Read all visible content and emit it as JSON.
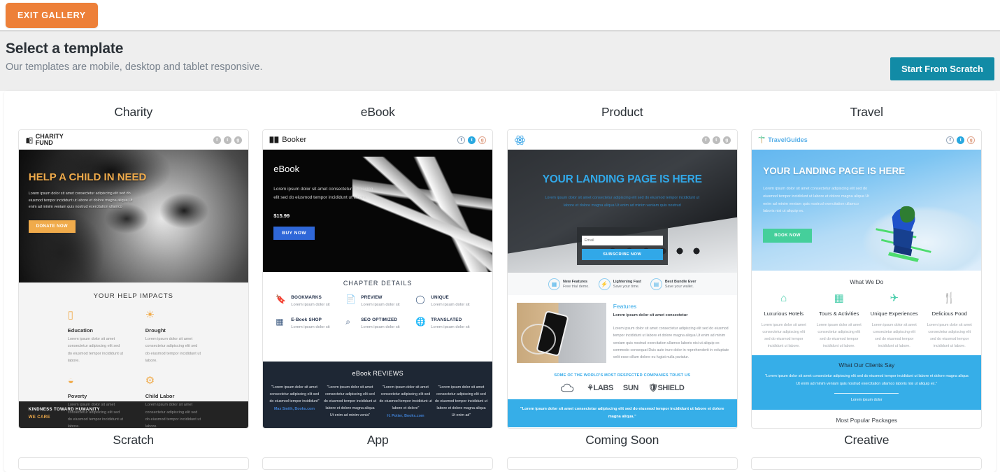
{
  "topbar": {
    "exit_label": "EXIT GALLERY"
  },
  "subheader": {
    "title": "Select a template",
    "subtitle": "Our templates are mobile, desktop and tablet responsive.",
    "scratch_label": "Start From Scratch"
  },
  "colors": {
    "exit_orange": "#ed8039",
    "scratch_teal": "#128ba6",
    "subheader_bg": "#eeeeee",
    "charity_accent": "#f0ab4b",
    "ebook_accent": "#2f67d8",
    "product_accent": "#31a8e8",
    "travel_accent": "#45cf9b"
  },
  "templates": [
    {
      "name": "Charity"
    },
    {
      "name": "eBook"
    },
    {
      "name": "Product"
    },
    {
      "name": "Travel"
    },
    {
      "name": "Scratch"
    },
    {
      "name": "App"
    },
    {
      "name": "Coming Soon"
    },
    {
      "name": "Creative"
    }
  ],
  "charity": {
    "logo_line1": "CHARITY",
    "logo_line2": "FUND",
    "hero_title": "HELP A CHILD IN NEED",
    "hero_body": "Lorem ipsum dolor sit amet consectetur adipiscing elit sed do eiusmod tempor incididunt ut labore et dolore magna aliqua Ut enim ad minim veniam quis nostrud exercitation ullamco",
    "cta": "DONATE NOW",
    "section_title": "YOUR HELP IMPACTS",
    "items": [
      {
        "icon": "book-icon",
        "glyph": "▯",
        "title": "Education",
        "body": "Lorem ipsum dolor sit amet consectetur adipiscing elit sed do eiusmod tempor incididunt ut labore."
      },
      {
        "icon": "sun-icon",
        "glyph": "☀",
        "title": "Drought",
        "body": "Lorem ipsum dolor sit amet consectetur adipiscing elit sed do eiusmod tempor incididunt ut labore."
      },
      {
        "icon": "bowl-icon",
        "glyph": "◒",
        "title": "Poverty",
        "body": "Lorem ipsum dolor sit amet consectetur adipiscing elit sed do eiusmod tempor incididunt ut labore."
      },
      {
        "icon": "gears-icon",
        "glyph": "⚙",
        "title": "Child Labor",
        "body": "Lorem ipsum dolor sit amet consectetur adipiscing elit sed do eiusmod tempor incididunt ut labore."
      }
    ],
    "footer_line1": "KINDNESS TOWARD HUMANITY",
    "footer_line2": "WE CARE"
  },
  "ebook": {
    "logo": "Booker",
    "hero_title": "eBook",
    "hero_body": "Lorem ipsum dolor sit amet consectetur adipiscing elit sed do eiusmod tempor incididunt ut labore.",
    "price": "$15.99",
    "cta": "BUY NOW",
    "section_title": "CHAPTER DETAILS",
    "features": [
      {
        "icon": "bookmark-icon",
        "glyph": "🔖",
        "title": "BOOKMARKS",
        "body": "Lorem ipsum dolor sit"
      },
      {
        "icon": "document-icon",
        "glyph": "📄",
        "title": "PREVIEW",
        "body": "Lorem ipsum dolor sit"
      },
      {
        "icon": "location-pin-icon",
        "glyph": "📍",
        "title": "UNIQUE",
        "body": "Lorem ipsum dolor sit"
      },
      {
        "icon": "shop-icon",
        "glyph": "🏪",
        "title": "E-Book SHOP",
        "body": "Lorem ipsum dolor sit"
      },
      {
        "icon": "magnifier-icon",
        "glyph": "🔍",
        "title": "SEO OPTIMIZED",
        "body": "Lorem ipsum dolor sit"
      },
      {
        "icon": "globe-icon",
        "glyph": "🌐",
        "title": "TRANSLATED",
        "body": "Lorem ipsum dolor sit"
      }
    ],
    "reviews_title": "eBook REVIEWS",
    "reviews": [
      {
        "text": "\"Lorem ipsum dolor sit amet consectetur adipiscing elit sed do eiusmod tempor incididunt\"",
        "author": "Max Smith, Books.com"
      },
      {
        "text": "\"Lorem ipsum dolor sit amet consectetur adipiscing elit sed do eiusmod tempor incididunt ut labore et dolore magna aliqua Ut enim ad minim venia\"",
        "author": ""
      },
      {
        "text": "\"Lorem ipsum dolor sit amet consectetur adipiscing elit sed do eiusmod tempor incididunt ut labore et dolore\"",
        "author": "H. Potter, Books.com"
      },
      {
        "text": "\"Lorem ipsum dolor sit amet consectetur adipiscing elit sed do eiusmod tempor incididunt ut labore et dolore magna aliqua Ut enim ad\"",
        "author": ""
      }
    ]
  },
  "product": {
    "logo": "atom-icon",
    "hero_title": "YOUR LANDING PAGE IS HERE",
    "hero_body": "Lorem ipsum dolor sit amet consectetur adipiscing elit sed do eiusmod tempor incididunt ut labore et dolore magna aliqua Ut enim ad minim veniam quis nostrud",
    "email_placeholder": "Email",
    "subscribe_label": "SUBSCRIBE NOW",
    "features": [
      {
        "icon": "card-icon",
        "glyph": "▤",
        "title": "New Features",
        "sub": "Free trial demo."
      },
      {
        "icon": "bolt-icon",
        "glyph": "⚡",
        "title": "Lightening Fast",
        "sub": "Save your time."
      },
      {
        "icon": "map-icon",
        "glyph": "🗺",
        "title": "Best Bundle Ever",
        "sub": "Save your wallet."
      }
    ],
    "features_title": "Features",
    "features_sub": "Lorem ipsum dolor sit amet consectetur",
    "features_body": "Lorem ipsum dolor sit amet consectetur adipiscing elit sed do eiusmod tempor incididunt ut labore et dolore magna aliqua Ut enim ad minim veniam quis nostrud exercitation ullamco laboris nisi ut aliquip ex commodo consequat Duis aute irure dolor in reprehenderit in voluptate velit esse cillum dolore eu fugiat nulla pariatur.",
    "trust_title": "SOME OF THE WORLD'S MOST RESPECTED COMPANIES TRUST US",
    "logos": [
      {
        "icon": "cloud-icon",
        "label": ""
      },
      {
        "icon": "labs-icon",
        "label": "LABS"
      },
      {
        "icon": "sun-logo-icon",
        "label": "SUN"
      },
      {
        "icon": "shield-icon",
        "label": "SHIELD"
      }
    ],
    "quote": "\"Lorem ipsum dolor sit amet consectetur adipiscing elit sed do eiusmod tempor incididunt ut labore et dolore magna aliqua.\""
  },
  "travel": {
    "logo": "TravelGuides",
    "hero_title": "YOUR LANDING PAGE IS HERE",
    "hero_body": "Lorem ipsum dolor sit amet consectetur adipiscing elit sed do eiusmod tempor incididunt ut labore et dolore magna aliqua Ut enim ad minim veniam quis nostrud exercitation ullamco laboris nisi ut aliquip ex.",
    "cta": "BOOK NOW",
    "section_title": "What We Do",
    "items": [
      {
        "icon": "home-icon",
        "glyph": "⌂",
        "title": "Luxurious Hotels",
        "body": "Lorem ipsum dolor sit amet consectetur adipiscing elit sed do eiusmod tempor incididunt ut labore."
      },
      {
        "icon": "ticket-icon",
        "glyph": "▤",
        "title": "Tours & Activities",
        "body": "Lorem ipsum dolor sit amet consectetur adipiscing elit sed do eiusmod tempor incididunt ut labore."
      },
      {
        "icon": "plane-icon",
        "glyph": "✈",
        "title": "Unique Experiences",
        "body": "Lorem ipsum dolor sit amet consectetur adipiscing elit sed do eiusmod tempor incididunt ut labore."
      },
      {
        "icon": "cutlery-icon",
        "glyph": "✕",
        "title": "Delicious Food",
        "body": "Lorem ipsum dolor sit amet consectetur adipiscing elit sed do eiusmod tempor incididunt ut labore."
      }
    ],
    "testimonial_title": "What Our Clients Say",
    "testimonial_body": "\"Lorem ipsum dolor sit amet consectetur adipiscing elit sed do eiusmod tempor incididunt ut labore et dolore magna aliqua Ut enim ad minim veniam quis nostrud exercitation ullamco laboris nisi ut aliquip ex.\"",
    "testimonial_author": "Lorem ipsum dolor",
    "packages_title": "Most Popular Packages"
  }
}
